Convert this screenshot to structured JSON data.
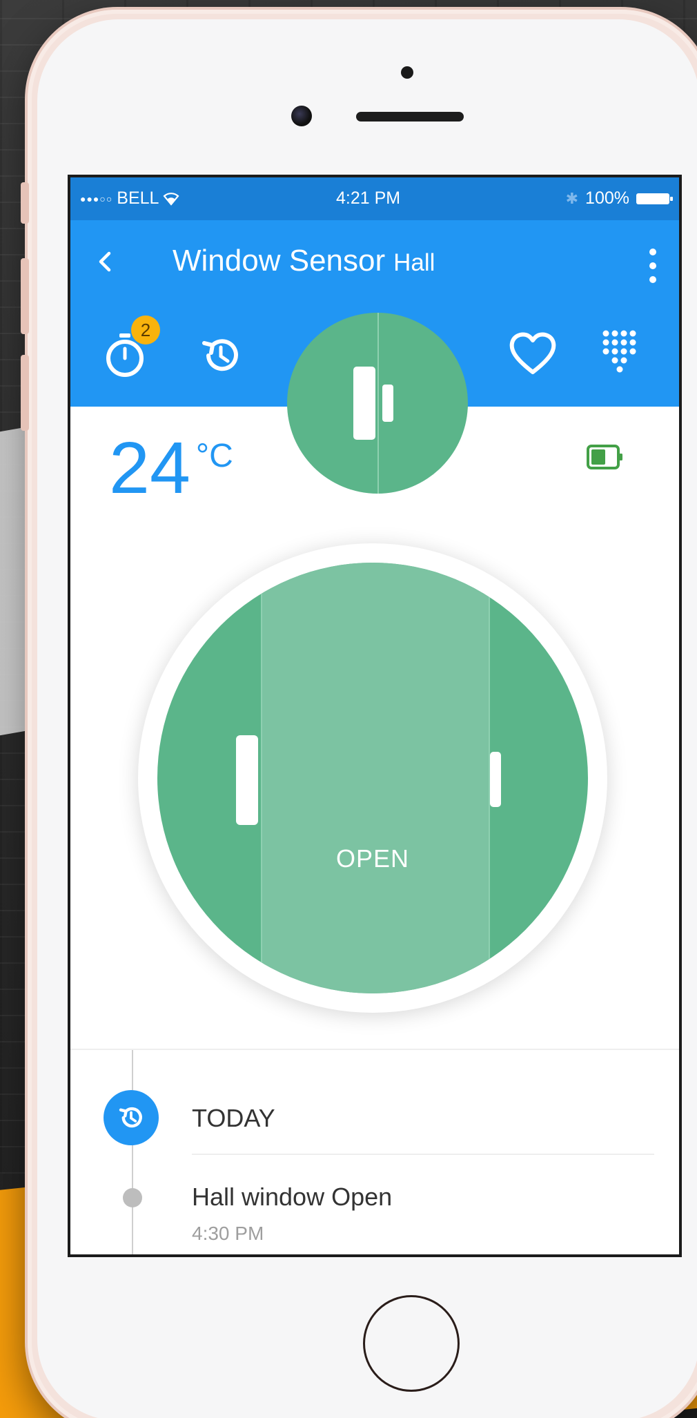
{
  "status_bar": {
    "carrier": "BELL",
    "time": "4:21 PM",
    "battery": "100%"
  },
  "app_bar": {
    "title": "Window Sensor",
    "subtitle": "Hall",
    "timer_badge_count": "2"
  },
  "sensor": {
    "temperature": "24",
    "temperature_unit": "°C",
    "state": "OPEN",
    "state_color": "#5bb58a",
    "accent_color": "#2196f3"
  },
  "history": {
    "group_label": "TODAY",
    "events": [
      {
        "title": "Hall window Open",
        "time": "4:30 PM"
      }
    ]
  },
  "icons": [
    "back-arrow-icon",
    "more-vert-icon",
    "timer-icon",
    "history-icon",
    "heart-icon",
    "keypad-icon",
    "battery-icon",
    "wifi-icon",
    "bluetooth-icon"
  ]
}
